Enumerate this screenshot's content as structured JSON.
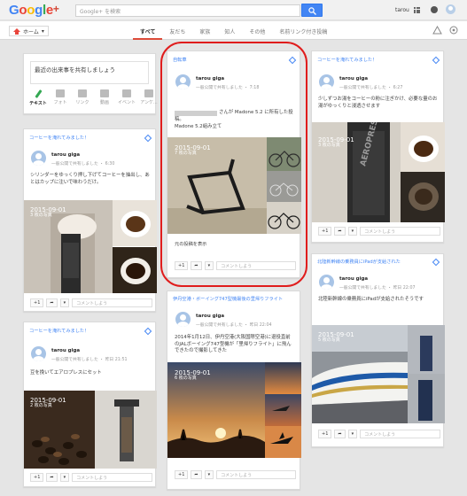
{
  "header": {
    "logo": "Google",
    "logo_plus": "+",
    "search_placeholder": "Google+ を検索",
    "username": "tarou"
  },
  "nav": {
    "home_label": "ホーム",
    "tabs": [
      {
        "label": "すべて"
      },
      {
        "label": "友だち"
      },
      {
        "label": "家族"
      },
      {
        "label": "知人"
      },
      {
        "label": "その他"
      },
      {
        "label": "名前リンク付き投稿"
      }
    ]
  },
  "share": {
    "prompt": "最近の出来事を共有しましょう",
    "options": [
      "テキスト",
      "フォト",
      "リンク",
      "動画",
      "イベント",
      "アンケ..."
    ]
  },
  "posts": [
    {
      "collection": "コーヒーを淹れてみました！",
      "author": "tarou giga",
      "meta": "一般公開で共有しました ・ 6:30",
      "text": "シリンダーをゆっくり押し下げてコーヒーを抽出し、あとはカップに注いで味わうだけ。",
      "photo_date": "2015-09-01",
      "photo_count": "3 枚の写真",
      "plus": "+1",
      "comment": "コメントしよう"
    },
    {
      "collection": "自転車",
      "author": "tarou giga",
      "meta": "一般公開で共有しました ・ 7:18",
      "text1": "さんが Madone 5.2 に所有した投稿。",
      "text2": "Madone 5.2組み立て",
      "photo_date": "2015-09-01",
      "photo_count": "7 枚の写真",
      "link": "元の投稿を表示",
      "plus": "+1",
      "comment": "コメントしよう"
    },
    {
      "collection": "コーヒーを淹れてみました！",
      "author": "tarou giga",
      "meta": "一般公開で共有しました ・ 6:27",
      "text": "少しずつお湯をコーヒーの粉に注ぎかけ、必要な量のお湯がゆっくりと浸透させます",
      "photo_date": "2015-09-01",
      "photo_count": "3 枚の写真",
      "plus": "+1",
      "comment": "コメントしよう"
    },
    {
      "collection": "コーヒーを淹れてみました！",
      "author": "tarou giga",
      "meta": "一般公開で共有しました ・ 昨日 21:51",
      "text": "豆を挽いてエアロプレスにセット",
      "photo_date": "2015-09-01",
      "photo_count": "2 枚の写真",
      "plus": "+1",
      "comment": "コメントしよう"
    },
    {
      "collection": "伊丹空港・ボーイング747型機最後の里帰りフライト",
      "author": "tarou giga",
      "meta": "一般公開で共有しました ・ 昨日 22:04",
      "text": "2014年1月12日、伊丹空港(大阪国際空港)に退役直前のJALボーイング747型機が「里帰りフライト」に飛んできたので撮影してきた",
      "photo_date": "2015-09-01",
      "photo_count": "6 枚の写真",
      "plus": "+1",
      "comment": "コメントしよう"
    },
    {
      "collection": "北陸新幹線の乗務員にiPadが支給された",
      "author": "tarou giga",
      "meta": "一般公開で共有しました ・ 昨日 22:07",
      "text": "北陸新幹線の乗務員にiPadが支給されたそうです",
      "photo_date": "2015-09-01",
      "photo_count": "5 枚の写真",
      "plus": "+1",
      "comment": "コメントしよう"
    }
  ],
  "colors": {
    "accent": "#4285f4",
    "highlight_ring": "#e01d1d"
  }
}
